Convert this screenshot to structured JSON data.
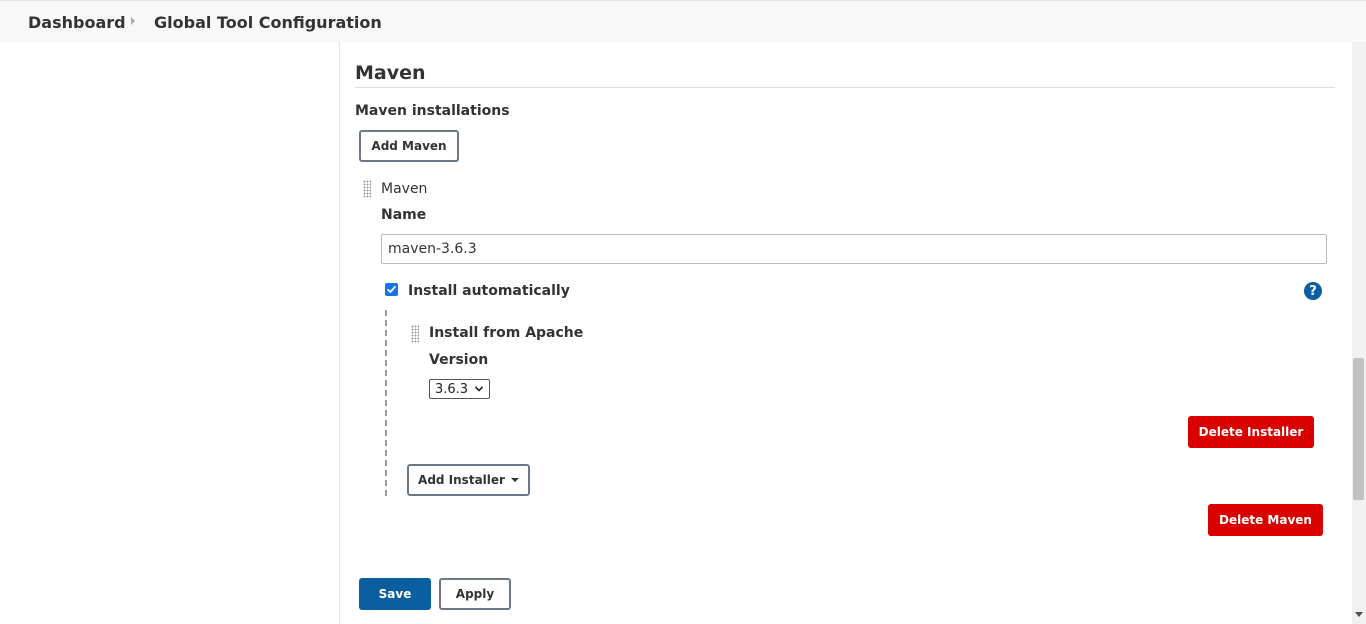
{
  "breadcrumb": {
    "items": [
      "Dashboard",
      "Global Tool Configuration"
    ]
  },
  "section": {
    "title": "Maven",
    "installations_label": "Maven installations",
    "add_button": "Add Maven"
  },
  "installation": {
    "header": "Maven",
    "name_label": "Name",
    "name_value": "maven-3.6.3",
    "install_auto_label": "Install automatically",
    "install_auto_checked": true,
    "help_icon": "?",
    "installer": {
      "title": "Install from Apache",
      "version_label": "Version",
      "version_value": "3.6.3",
      "delete_button": "Delete Installer"
    },
    "add_installer_button": "Add Installer",
    "delete_button": "Delete Maven"
  },
  "actions": {
    "save": "Save",
    "apply": "Apply"
  },
  "colors": {
    "primary": "#0b5fa1",
    "danger": "#d90000",
    "checkbox": "#1a73e8"
  }
}
